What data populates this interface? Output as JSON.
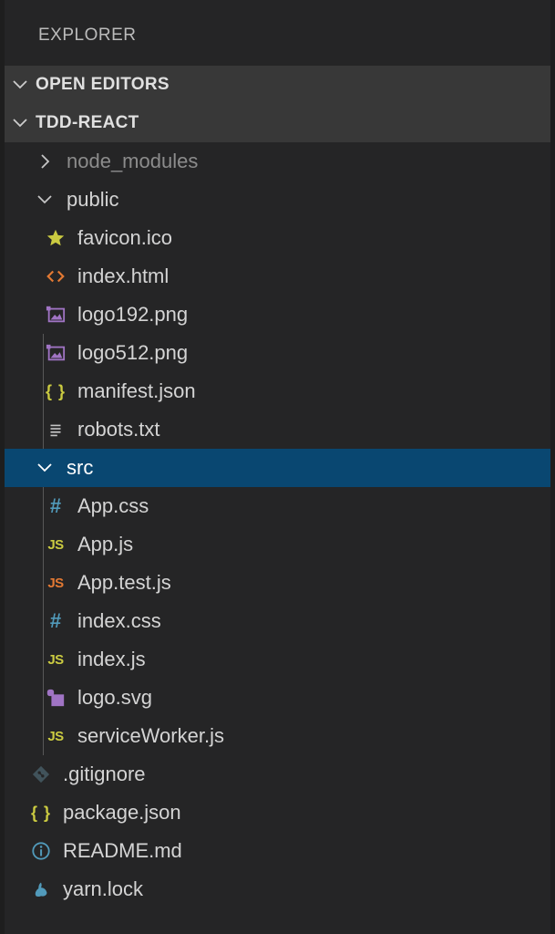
{
  "explorer": {
    "title": "EXPLORER"
  },
  "sections": {
    "open_editors": "OPEN EDITORS",
    "project": "TDD-REACT"
  },
  "tree": {
    "node_modules": "node_modules",
    "public": {
      "label": "public",
      "files": [
        "favicon.ico",
        "index.html",
        "logo192.png",
        "logo512.png",
        "manifest.json",
        "robots.txt"
      ]
    },
    "src": {
      "label": "src",
      "files": [
        "App.css",
        "App.js",
        "App.test.js",
        "index.css",
        "index.js",
        "logo.svg",
        "serviceWorker.js"
      ]
    },
    "root_files": [
      ".gitignore",
      "package.json",
      "README.md",
      "yarn.lock"
    ]
  },
  "icon_glyphs": {
    "js": "JS",
    "css": "#",
    "json": "{ }"
  },
  "colors": {
    "selected": "#094771",
    "js": "#cbcb41",
    "test_js": "#e37933",
    "css": "#519aba",
    "image": "#a074c4",
    "html": "#e37933"
  }
}
